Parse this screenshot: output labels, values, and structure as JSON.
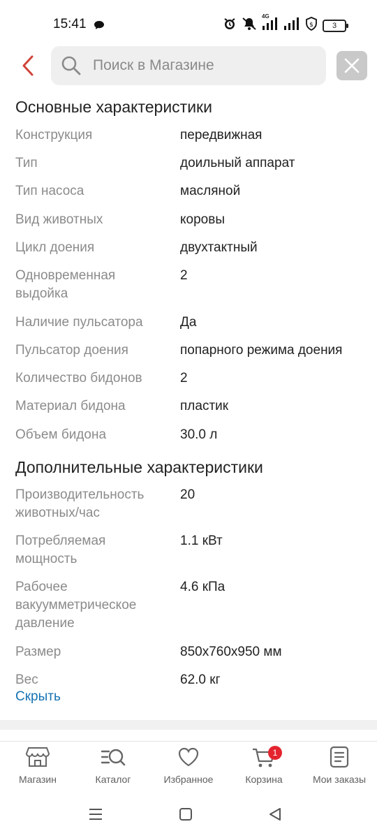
{
  "status_bar": {
    "time": "15:41",
    "network": "4G",
    "battery": "3",
    "icons": [
      "chat-icon",
      "alarm-icon",
      "mute-icon",
      "signal-icon",
      "signal-icon",
      "shield-icon",
      "battery-icon"
    ]
  },
  "search": {
    "placeholder": "Поиск в Магазине"
  },
  "main_specs": {
    "title": "Основные характеристики",
    "rows": [
      {
        "key": "Конструкция",
        "value": "передвижная"
      },
      {
        "key": "Тип",
        "value": "доильный аппарат"
      },
      {
        "key": "Тип насоса",
        "value": "масляной"
      },
      {
        "key": "Вид животных",
        "value": "коровы"
      },
      {
        "key": "Цикл доения",
        "value": "двухтактный"
      },
      {
        "key": "Одновременная выдойка",
        "value": "2"
      },
      {
        "key": "Наличие пульсатора",
        "value": "Да"
      },
      {
        "key": "Пульсатор доения",
        "value": "попарного режима доения"
      },
      {
        "key": "Количество бидонов",
        "value": "2"
      },
      {
        "key": "Материал бидона",
        "value": "пластик"
      },
      {
        "key": "Объем бидона",
        "value": "30.0 л"
      }
    ]
  },
  "extra_specs": {
    "title": "Дополнительные характеристики",
    "rows": [
      {
        "key": "Производительность животных/час",
        "value": "20"
      },
      {
        "key": "Потребляемая мощность",
        "value": "1.1 кВт"
      },
      {
        "key": "Рабочее вакуумметрическое давление",
        "value": "4.6 кПа"
      },
      {
        "key": "Размер",
        "value": "850x760x950 мм"
      },
      {
        "key": "Вес",
        "value": "62.0 кг"
      }
    ]
  },
  "hide_link": "Скрыть",
  "tabbar": {
    "items": [
      {
        "label": "Магазин",
        "icon": "store-icon"
      },
      {
        "label": "Каталог",
        "icon": "catalog-search-icon"
      },
      {
        "label": "Избранное",
        "icon": "heart-icon"
      },
      {
        "label": "Корзина",
        "icon": "cart-icon",
        "badge": "1"
      },
      {
        "label": "Мои заказы",
        "icon": "orders-icon"
      }
    ]
  },
  "colors": {
    "accent_back": "#d0443a",
    "link": "#1673b3",
    "badge": "#e4242f"
  }
}
